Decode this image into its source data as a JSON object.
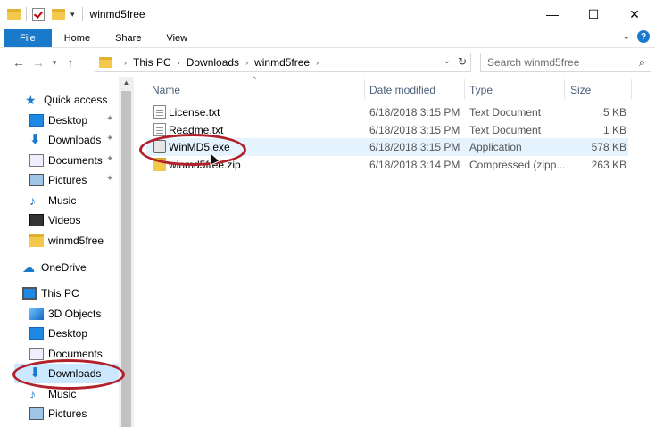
{
  "window": {
    "title": "winmd5free"
  },
  "ribbon": {
    "tabs": [
      "File",
      "Home",
      "Share",
      "View"
    ]
  },
  "address": {
    "crumbs": [
      "This PC",
      "Downloads",
      "winmd5free"
    ]
  },
  "search": {
    "placeholder": "Search winmd5free"
  },
  "nav": {
    "quick_access": "Quick access",
    "items": [
      "Desktop",
      "Downloads",
      "Documents",
      "Pictures",
      "Music",
      "Videos",
      "winmd5free"
    ],
    "onedrive": "OneDrive",
    "this_pc": "This PC",
    "pc_items": [
      "3D Objects",
      "Desktop",
      "Documents",
      "Downloads",
      "Music",
      "Pictures"
    ]
  },
  "columns": {
    "name": "Name",
    "date": "Date modified",
    "type": "Type",
    "size": "Size"
  },
  "files": [
    {
      "name": "License.txt",
      "date": "6/18/2018 3:15 PM",
      "type": "Text Document",
      "size": "5 KB"
    },
    {
      "name": "Readme.txt",
      "date": "6/18/2018 3:15 PM",
      "type": "Text Document",
      "size": "1 KB"
    },
    {
      "name": "WinMD5.exe",
      "date": "6/18/2018 3:15 PM",
      "type": "Application",
      "size": "578 KB"
    },
    {
      "name": "winmd5free.zip",
      "date": "6/18/2018 3:14 PM",
      "type": "Compressed (zipp...",
      "size": "263 KB"
    }
  ],
  "colors": {
    "accent": "#1979ca",
    "annotation": "#b2202a",
    "selection": "#cce8ff"
  }
}
